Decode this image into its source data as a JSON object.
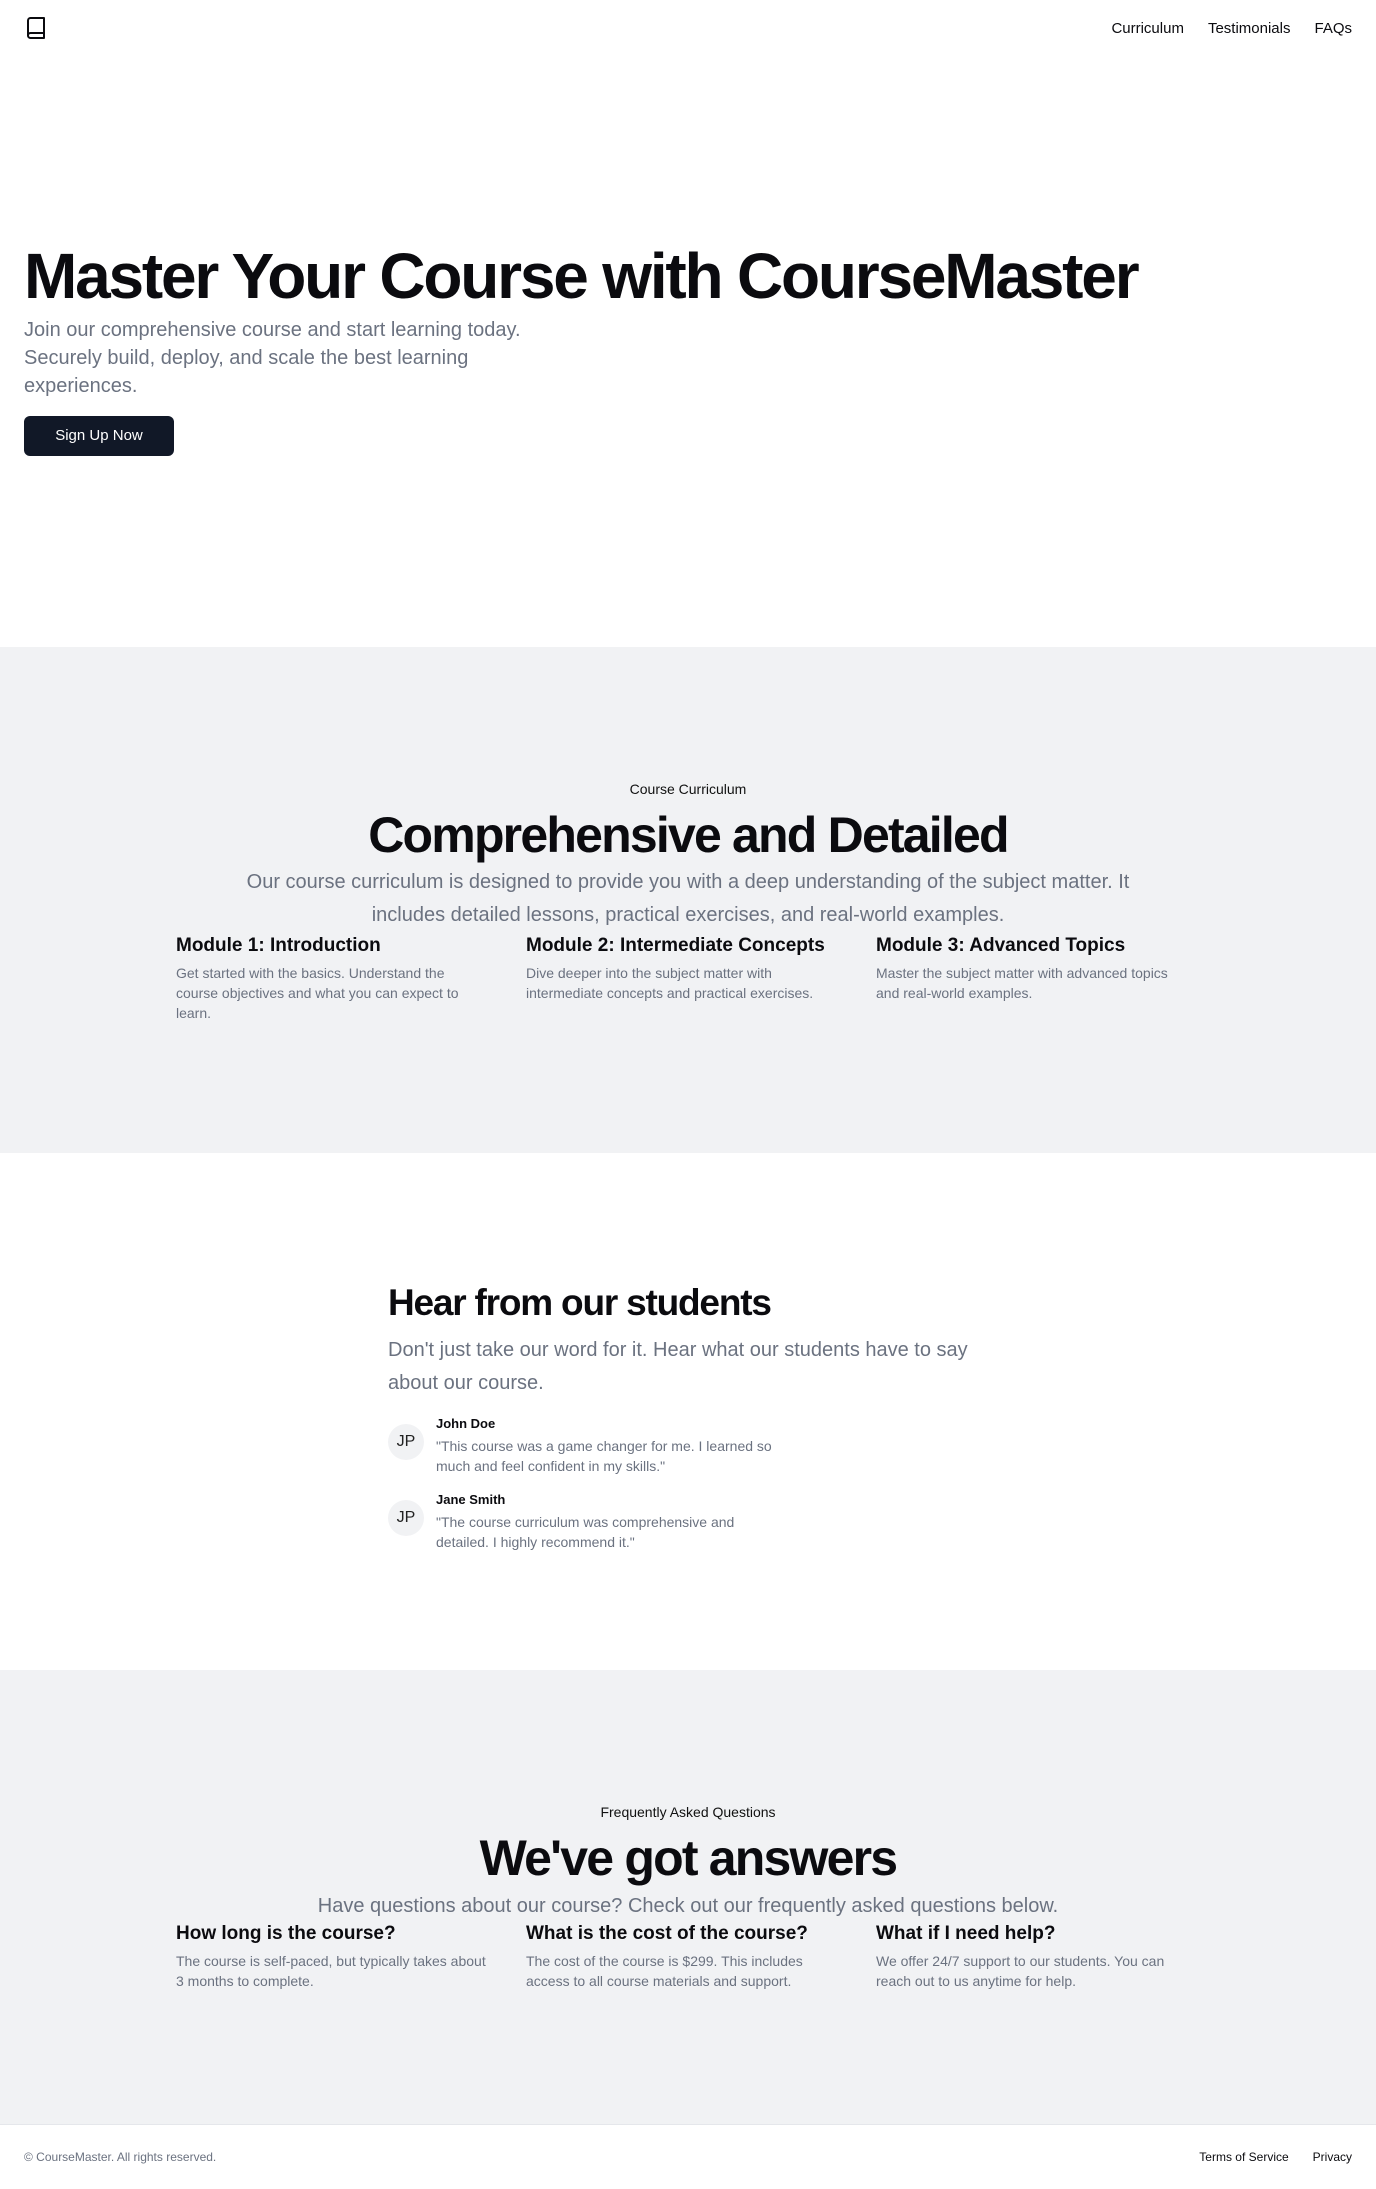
{
  "header": {
    "logo_icon": "book-icon",
    "nav": [
      {
        "label": "Curriculum"
      },
      {
        "label": "Testimonials"
      },
      {
        "label": "FAQs"
      }
    ]
  },
  "hero": {
    "title": "Master Your Course with CourseMaster",
    "subtitle": "Join our comprehensive course and start learning today. Securely build, deploy, and scale the best learning experiences.",
    "cta_label": "Sign Up Now"
  },
  "curriculum": {
    "eyebrow": "Course Curriculum",
    "title": "Comprehensive and Detailed",
    "lead": "Our course curriculum is designed to provide you with a deep understanding of the subject matter. It includes detailed lessons, practical exercises, and real-world examples.",
    "modules": [
      {
        "title": "Module 1: Introduction",
        "text": "Get started with the basics. Understand the course objectives and what you can expect to learn."
      },
      {
        "title": "Module 2: Intermediate Concepts",
        "text": "Dive deeper into the subject matter with intermediate concepts and practical exercises."
      },
      {
        "title": "Module 3: Advanced Topics",
        "text": "Master the subject matter with advanced topics and real-world examples."
      }
    ]
  },
  "testimonials": {
    "title": "Hear from our students",
    "lead": "Don't just take our word for it. Hear what our students have to say about our course.",
    "items": [
      {
        "initials": "JP",
        "name": "John Doe",
        "quote": "\"This course was a game changer for me. I learned so much and feel confident in my skills.\""
      },
      {
        "initials": "JP",
        "name": "Jane Smith",
        "quote": "\"The course curriculum was comprehensive and detailed. I highly recommend it.\""
      }
    ]
  },
  "faq": {
    "eyebrow": "Frequently Asked Questions",
    "title": "We've got answers",
    "lead": "Have questions about our course? Check out our frequently asked questions below.",
    "items": [
      {
        "q": "How long is the course?",
        "a": "The course is self-paced, but typically takes about 3 months to complete."
      },
      {
        "q": "What is the cost of the course?",
        "a": "The cost of the course is $299. This includes access to all course materials and support."
      },
      {
        "q": "What if I need help?",
        "a": "We offer 24/7 support to our students. You can reach out to us anytime for help."
      }
    ]
  },
  "footer": {
    "copyright": "© CourseMaster. All rights reserved.",
    "links": [
      {
        "label": "Terms of Service"
      },
      {
        "label": "Privacy"
      }
    ]
  },
  "colors": {
    "primary_button": "#111827",
    "section_background": "#f1f2f4",
    "muted_text": "#6b7280"
  }
}
